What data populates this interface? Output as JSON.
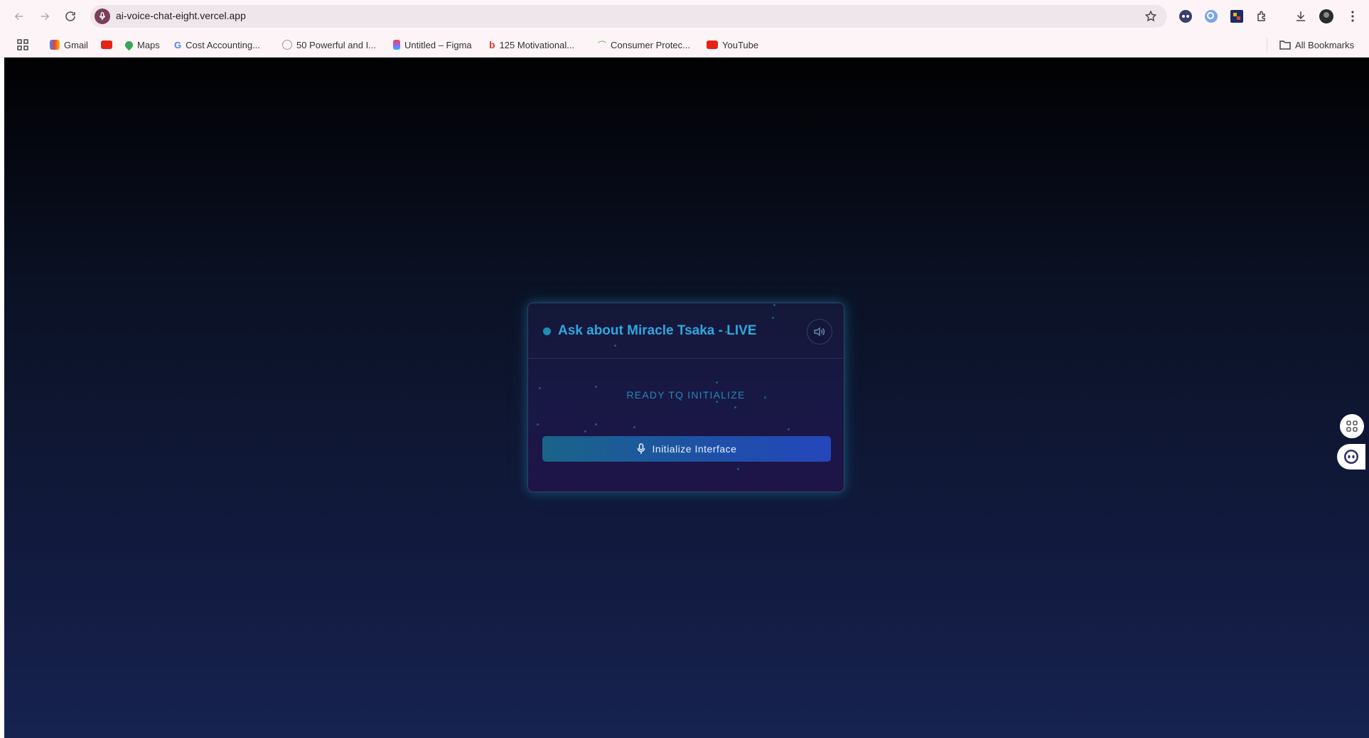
{
  "browser": {
    "url": "ai-voice-chat-eight.vercel.app",
    "bookmarks": [
      {
        "label": "Gmail"
      },
      {
        "label": ""
      },
      {
        "label": "Maps"
      },
      {
        "label": "Cost Accounting..."
      },
      {
        "label": "50 Powerful and I..."
      },
      {
        "label": "Untitled – Figma"
      },
      {
        "label": "125 Motivational..."
      },
      {
        "label": "Consumer Protec..."
      },
      {
        "label": "YouTube"
      }
    ],
    "all_bookmarks_label": "All Bookmarks"
  },
  "app": {
    "title": "Ask about Miracle Tsaka - LIVE",
    "status": "READY TQ INITIALIZE",
    "button_label": "Initialize Interface"
  },
  "colors": {
    "accent": "#2fa6e0",
    "button_start": "#1a6489",
    "button_end": "#2546bb",
    "background_top": "#010103",
    "background_bottom": "#162250"
  }
}
